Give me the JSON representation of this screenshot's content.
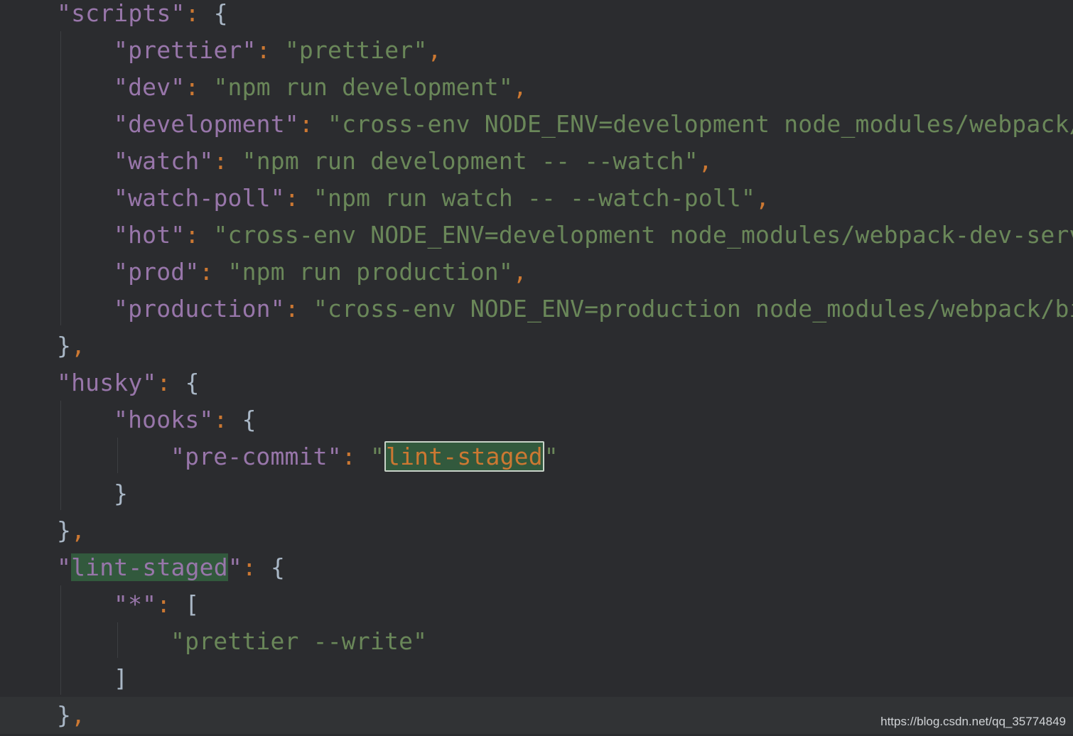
{
  "editor": {
    "lines": [
      {
        "indent": 4,
        "tokens": [
          [
            "key",
            "\"scripts\""
          ],
          [
            "colon",
            ":"
          ],
          [
            "punct",
            " {"
          ]
        ]
      },
      {
        "indent": 8,
        "tokens": [
          [
            "key",
            "\"prettier\""
          ],
          [
            "colon",
            ":"
          ],
          [
            "str",
            " \"prettier\""
          ],
          [
            "comma",
            ","
          ]
        ]
      },
      {
        "indent": 8,
        "tokens": [
          [
            "key",
            "\"dev\""
          ],
          [
            "colon",
            ":"
          ],
          [
            "str",
            " \"npm run development\""
          ],
          [
            "comma",
            ","
          ]
        ]
      },
      {
        "indent": 8,
        "tokens": [
          [
            "key",
            "\"development\""
          ],
          [
            "colon",
            ":"
          ],
          [
            "str",
            " \"cross-env NODE_ENV=development node_modules/webpack/"
          ]
        ]
      },
      {
        "indent": 8,
        "tokens": [
          [
            "key",
            "\"watch\""
          ],
          [
            "colon",
            ":"
          ],
          [
            "str",
            " \"npm run development -- --watch\""
          ],
          [
            "comma",
            ","
          ]
        ]
      },
      {
        "indent": 8,
        "tokens": [
          [
            "key",
            "\"watch-poll\""
          ],
          [
            "colon",
            ":"
          ],
          [
            "str",
            " \"npm run watch -- --watch-poll\""
          ],
          [
            "comma",
            ","
          ]
        ]
      },
      {
        "indent": 8,
        "tokens": [
          [
            "key",
            "\"hot\""
          ],
          [
            "colon",
            ":"
          ],
          [
            "str",
            " \"cross-env NODE_ENV=development node_modules/webpack-dev-serv"
          ]
        ]
      },
      {
        "indent": 8,
        "tokens": [
          [
            "key",
            "\"prod\""
          ],
          [
            "colon",
            ":"
          ],
          [
            "str",
            " \"npm run production\""
          ],
          [
            "comma",
            ","
          ]
        ]
      },
      {
        "indent": 8,
        "tokens": [
          [
            "key",
            "\"production\""
          ],
          [
            "colon",
            ":"
          ],
          [
            "str",
            " \"cross-env NODE_ENV=production node_modules/webpack/bi"
          ]
        ]
      },
      {
        "indent": 4,
        "tokens": [
          [
            "punct",
            "}"
          ],
          [
            "comma",
            ","
          ]
        ]
      },
      {
        "indent": 4,
        "tokens": [
          [
            "key",
            "\"husky\""
          ],
          [
            "colon",
            ":"
          ],
          [
            "punct",
            " {"
          ]
        ]
      },
      {
        "indent": 8,
        "tokens": [
          [
            "key",
            "\"hooks\""
          ],
          [
            "colon",
            ":"
          ],
          [
            "punct",
            " {"
          ]
        ]
      },
      {
        "indent": 12,
        "tokens": [
          [
            "key",
            "\"pre-commit\""
          ],
          [
            "colon",
            ":"
          ],
          [
            "str",
            " \""
          ],
          [
            "hlbox",
            "lint-staged"
          ],
          [
            "str",
            "\""
          ]
        ]
      },
      {
        "indent": 8,
        "tokens": [
          [
            "punct",
            "}"
          ]
        ]
      },
      {
        "indent": 4,
        "tokens": [
          [
            "punct",
            "}"
          ],
          [
            "comma",
            ","
          ]
        ]
      },
      {
        "indent": 4,
        "tokens": [
          [
            "key",
            "\""
          ],
          [
            "hlkey",
            "lint-staged"
          ],
          [
            "key",
            "\""
          ],
          [
            "colon",
            ":"
          ],
          [
            "punct",
            " {"
          ]
        ]
      },
      {
        "indent": 8,
        "tokens": [
          [
            "key",
            "\"*\""
          ],
          [
            "colon",
            ":"
          ],
          [
            "punct",
            " ["
          ]
        ]
      },
      {
        "indent": 12,
        "tokens": [
          [
            "str",
            "\"prettier --write\""
          ]
        ]
      },
      {
        "indent": 8,
        "tokens": [
          [
            "punct",
            "]"
          ]
        ]
      },
      {
        "indent": 4,
        "tokens": [
          [
            "punct",
            "}"
          ],
          [
            "comma",
            ","
          ]
        ],
        "current": true
      }
    ]
  },
  "watermark": "https://blog.csdn.net/qq_35774849"
}
